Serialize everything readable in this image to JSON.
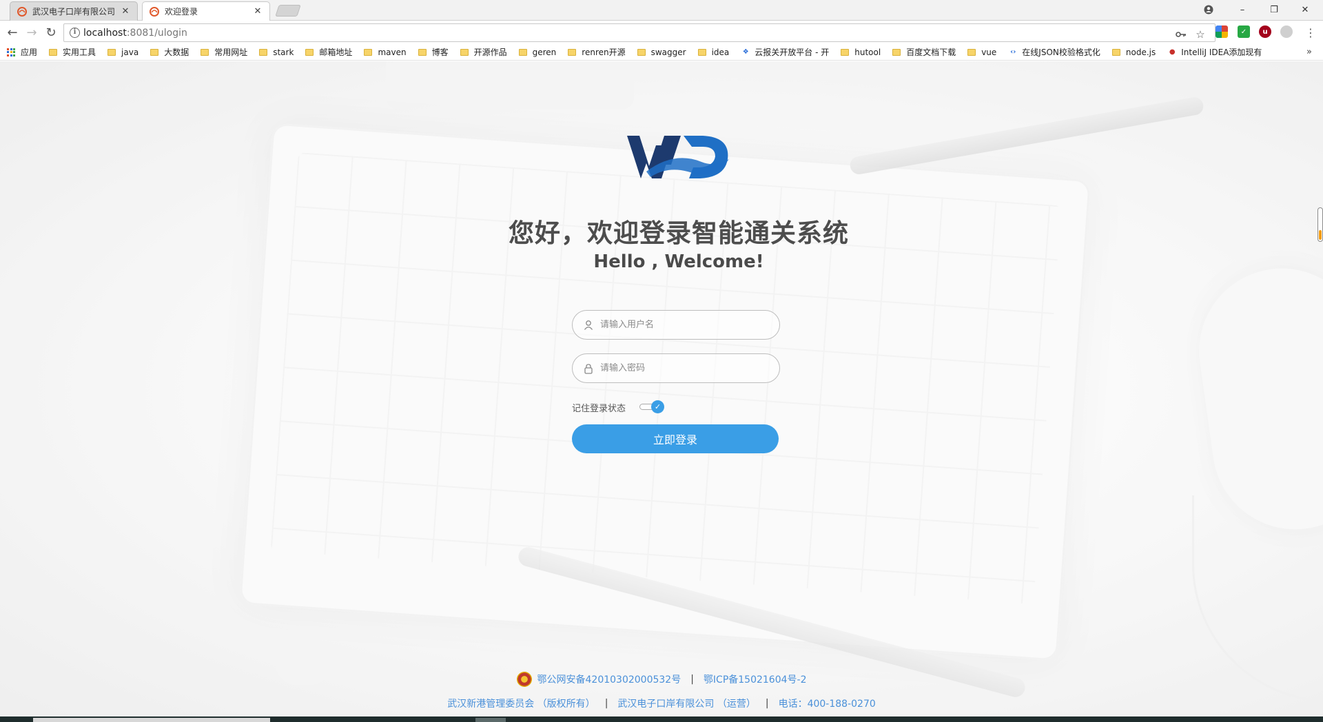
{
  "browser": {
    "tabs": [
      {
        "title": "武汉电子口岸有限公司",
        "active": false
      },
      {
        "title": "欢迎登录",
        "active": true
      }
    ],
    "window_controls": {
      "minimize": "–",
      "restore": "❐",
      "close": "✕"
    },
    "address": {
      "host": "localhost",
      "port_path": ":8081/ulogin"
    },
    "bookmarks": [
      {
        "label": "应用",
        "icon": "apps-grid-icon"
      },
      {
        "label": "实用工具",
        "icon": "folder-icon"
      },
      {
        "label": "java",
        "icon": "folder-icon"
      },
      {
        "label": "大数据",
        "icon": "folder-icon"
      },
      {
        "label": "常用网址",
        "icon": "folder-icon"
      },
      {
        "label": "stark",
        "icon": "folder-icon"
      },
      {
        "label": "邮箱地址",
        "icon": "folder-icon"
      },
      {
        "label": "maven",
        "icon": "folder-icon"
      },
      {
        "label": "博客",
        "icon": "folder-icon"
      },
      {
        "label": "开源作品",
        "icon": "folder-icon"
      },
      {
        "label": "geren",
        "icon": "folder-icon"
      },
      {
        "label": "renren开源",
        "icon": "folder-icon"
      },
      {
        "label": "swagger",
        "icon": "folder-icon"
      },
      {
        "label": "idea",
        "icon": "folder-icon"
      },
      {
        "label": "云报关开放平台 - 开",
        "icon": "site-icon"
      },
      {
        "label": "hutool",
        "icon": "folder-icon"
      },
      {
        "label": "百度文档下载",
        "icon": "folder-icon"
      },
      {
        "label": "vue",
        "icon": "folder-icon"
      },
      {
        "label": "在线JSON校验格式化",
        "icon": "code-icon"
      },
      {
        "label": "node.js",
        "icon": "folder-icon"
      },
      {
        "label": "IntelliJ IDEA添加现有",
        "icon": "csdn-icon"
      }
    ],
    "bookmarks_more": "»"
  },
  "login": {
    "heading": "您好，欢迎登录智能通关系统",
    "subheading": "Hello , Welcome!",
    "username_placeholder": "请输入用户名",
    "password_placeholder": "请输入密码",
    "remember_label": "记住登录状态",
    "remember_checked": true,
    "submit_label": "立即登录"
  },
  "footer": {
    "police_record": "鄂公网安备42010302000532号",
    "icp_record": "鄂ICP备15021604号-2",
    "owner": "武汉新港管理委员会 （版权所有）",
    "operator": "武汉电子口岸有限公司 （运营）",
    "phone": "电话：400-188-0270",
    "separator": "|"
  },
  "colors": {
    "accent": "#3a9ee6",
    "link": "#4a90d9",
    "logo_navy": "#1d3a6e",
    "logo_blue": "#1f6fc5"
  }
}
